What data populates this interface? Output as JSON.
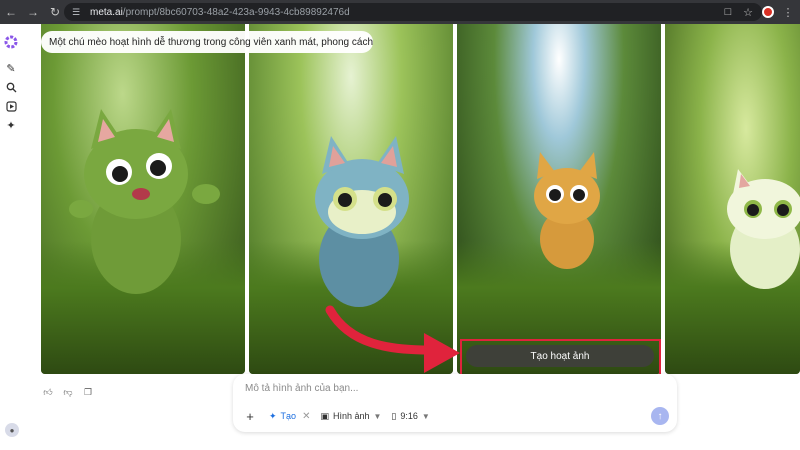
{
  "browser": {
    "url_host": "meta.ai",
    "url_path": "/prompt/8bc60703-48a2-423a-9943-4cb89892476d"
  },
  "gallery": {
    "prompt_text": "Một chú mèo hoạt hình dễ thương trong công viên xanh mát, phong cách ...",
    "animate_button_label": "Tạo hoạt ảnh"
  },
  "composer": {
    "placeholder": "Mô tả hình ảnh của bạn...",
    "create_label": "Tạo",
    "image_label": "Hình ảnh",
    "ratio_label": "9:16"
  },
  "icons": {
    "brand": "meta-ai-logo-icon",
    "new_chat": "edit-icon",
    "search": "search-icon",
    "video": "play-icon",
    "imagine": "magic-wand-icon"
  },
  "colors": {
    "accent": "#1d6fe0",
    "highlight": "#e0233c",
    "send": "#a8b6f0"
  }
}
